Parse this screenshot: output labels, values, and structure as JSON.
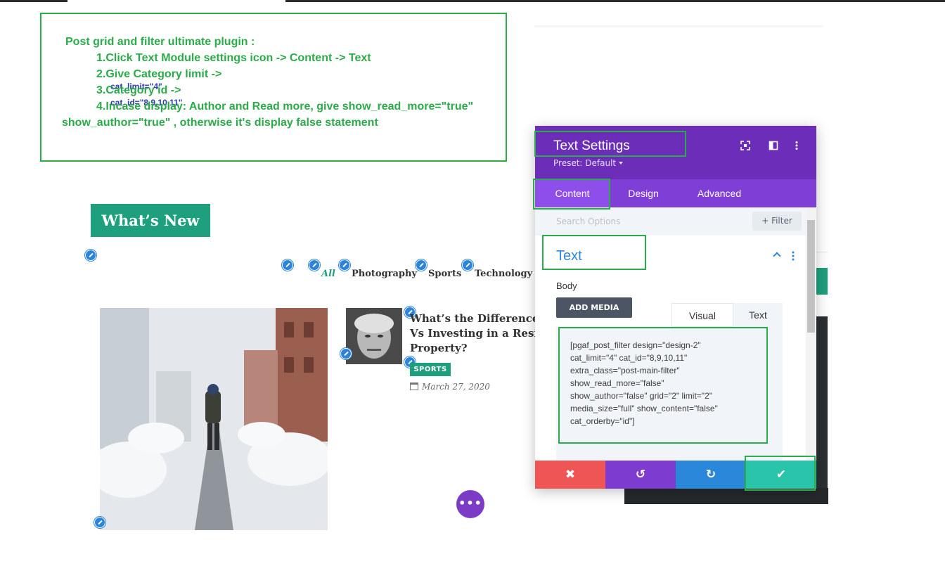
{
  "instructions": {
    "heading": "Post grid and filter ultimate plugin :",
    "step1": "1.Click Text Module settings icon -> Content -> Text",
    "step2_text": "2.Give Category limit -> ",
    "step2_code": "cat_limit=\"4\"",
    "step3_text": "3.Category id -> ",
    "step3_code": "cat_id=\"8,9,10,11\"",
    "step4_line1": "4.Incase display: Author and Read more, give show_read_more=\"true\"",
    "step4_line2": "show_author=\"true\" , otherwise it's display false statement"
  },
  "page": {
    "section_title": "What’s New",
    "filters": [
      "All",
      "Photography",
      "Sports",
      "Technology"
    ],
    "post": {
      "title_lines": [
        "What’s the Difference: B",
        "Vs Investing in a Reside",
        "Property?"
      ],
      "tag": "SPORTS",
      "date": "March 27, 2020"
    },
    "fab_label": "•••"
  },
  "panel": {
    "title": "Text Settings",
    "preset": "Preset: Default",
    "tabs": [
      "Content",
      "Design",
      "Advanced"
    ],
    "search_placeholder": "Search Options",
    "filter_label": "+ Filter",
    "section_title": "Text",
    "body_label": "Body",
    "add_media": "ADD MEDIA",
    "editor_tabs": [
      "Visual",
      "Text"
    ],
    "code_lines": [
      "[pgaf_post_filter design=\"design-2\"",
      "cat_limit=\"4\" cat_id=\"8,9,10,11\"",
      "extra_class=\"post-main-filter\"",
      "show_read_more=\"false\"",
      "show_author=\"false\" grid=\"2\" limit=\"2\"",
      "media_size=\"full\" show_content=\"false\"",
      "cat_orderby=\"id\"]"
    ],
    "footer": {
      "cancel": "✖",
      "undo": "↺",
      "redo": "↻",
      "save": "✔",
      "colors": {
        "cancel": "#ef5555",
        "undo": "#7e3bd0",
        "redo": "#2b87da",
        "save": "#29c4a9"
      }
    }
  },
  "colors": {
    "accent_green": "#2cab4a",
    "teal": "#1ea07f",
    "purple_header": "#6c2eb9",
    "purple_tabs": "#7f3fd6"
  }
}
